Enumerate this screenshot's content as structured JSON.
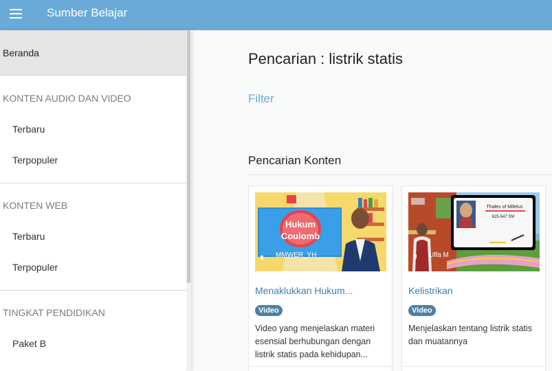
{
  "app": {
    "title": "Sumber Belajar"
  },
  "sidebar": {
    "home": "Beranda",
    "sections": [
      {
        "title": "KONTEN AUDIO DAN VIDEO",
        "items": [
          "Terbaru",
          "Terpopuler"
        ]
      },
      {
        "title": "KONTEN WEB",
        "items": [
          "Terbaru",
          "Terpopuler"
        ]
      },
      {
        "title": "TINGKAT PENDIDIKAN",
        "items": [
          "Paket B"
        ]
      }
    ]
  },
  "main": {
    "search_title": "Pencarian : listrik statis",
    "filter_label": "Filter",
    "section_title": "Pencarian Konten",
    "cards": [
      {
        "title": "Menaklukkan Hukum...",
        "badge": "Video",
        "description": "Video yang menjelaskan materi esensial berhubungan dengan listrik statis pada kehidupan...",
        "thumbnail": {
          "heading_line1": "Hukum",
          "heading_line2": "Coulomb",
          "overlay": "MMWER_YH"
        }
      },
      {
        "title": "Kelistrikan",
        "badge": "Video",
        "description": "Menjelaskan tentang listrik statis dan muatannya",
        "thumbnail": {
          "card_name": "Thales of Miletus",
          "card_years": "625-547 SM",
          "overlay": "Ulfa M"
        }
      }
    ]
  },
  "colors": {
    "header": "#6aaad8",
    "link": "#3a7fb5",
    "badge": "#4e80a6"
  }
}
